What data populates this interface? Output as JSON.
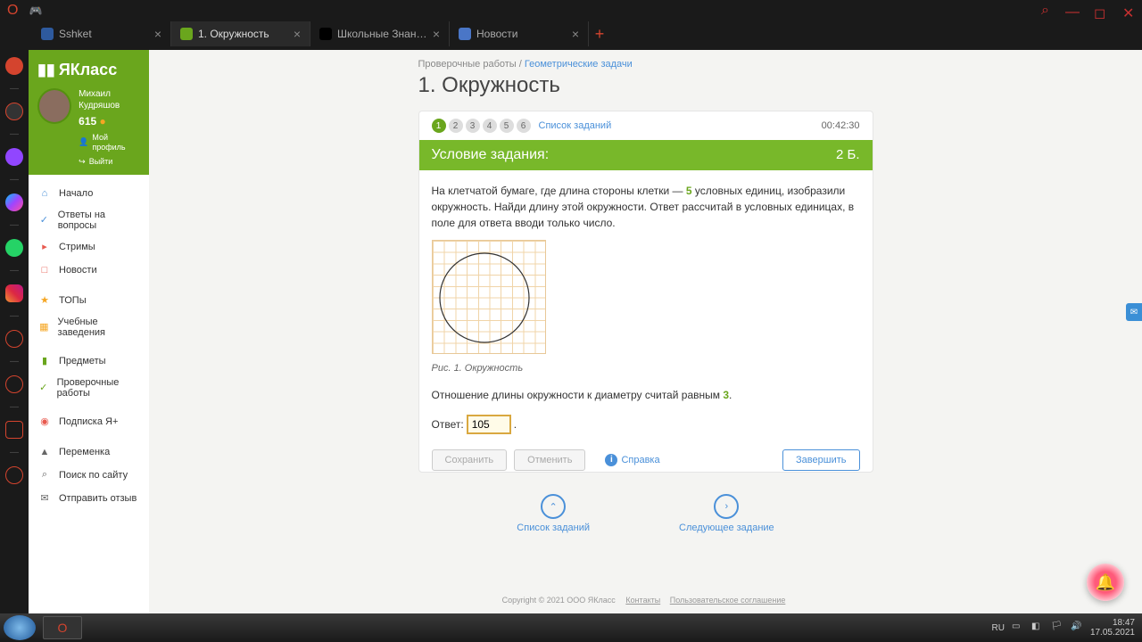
{
  "tabs": [
    {
      "label": "Sshket",
      "icon_bg": "#2e5a9e"
    },
    {
      "label": "1. Окружность",
      "icon_bg": "#6aa61d",
      "active": true
    },
    {
      "label": "Школьные Знания.com - П",
      "icon_bg": "#000"
    },
    {
      "label": "Новости",
      "icon_bg": "#4a76c7"
    }
  ],
  "url": {
    "domain": "www.yaklass.ru",
    "path": "/TestWorkRun/Exercise"
  },
  "sidebar": {
    "logo": "ЯКласс",
    "profile": {
      "name": "Михаил\nКудряшов",
      "score": "615",
      "my_profile": "Мой профиль",
      "logout": "Выйти"
    },
    "menu": [
      {
        "label": "Начало",
        "color": "#4a90d9",
        "glyph": "⌂"
      },
      {
        "label": "Ответы на вопросы",
        "color": "#4a90d9",
        "glyph": "✓"
      },
      {
        "label": "Стримы",
        "color": "#e85a4f",
        "glyph": "▸"
      },
      {
        "label": "Новости",
        "color": "#e85a4f",
        "glyph": "□"
      },
      {
        "sep": true
      },
      {
        "label": "ТОПы",
        "color": "#f5a623",
        "glyph": "★"
      },
      {
        "label": "Учебные заведения",
        "color": "#f5a623",
        "glyph": "▦"
      },
      {
        "sep": true
      },
      {
        "label": "Предметы",
        "color": "#6aa61d",
        "glyph": "▮"
      },
      {
        "label": "Проверочные работы",
        "color": "#6aa61d",
        "glyph": "✓"
      },
      {
        "sep": true
      },
      {
        "label": "Подписка Я+",
        "color": "#e85a4f",
        "glyph": "◉"
      },
      {
        "sep": true
      },
      {
        "label": "Переменка",
        "color": "#666",
        "glyph": "▲"
      },
      {
        "label": "Поиск по сайту",
        "color": "#666",
        "glyph": "⌕"
      },
      {
        "label": "Отправить отзыв",
        "color": "#666",
        "glyph": "✉"
      }
    ]
  },
  "breadcrumb": {
    "a": "Проверочные работы",
    "b": "Геометрические задачи"
  },
  "page_title": "1. Окружность",
  "steps": [
    "1",
    "2",
    "3",
    "4",
    "5",
    "6"
  ],
  "step_list": "Список заданий",
  "timer": "00:42:30",
  "green_bar": {
    "title": "Условие задания:",
    "points": "2 Б."
  },
  "task_text_1": "На клетчатой бумаге, где длина стороны клетки — ",
  "task_num1": "5",
  "task_text_2": " условных единиц, изобразили окружность. Найди длину этой окружности. Ответ рассчитай в условных единицах, в поле для ответа вводи только число.",
  "fig_caption": "Рис. 1. Окружность",
  "ratio_text": "Отношение длины окружности к диаметру считай равным ",
  "ratio_num": "3",
  "answer_label": "Ответ:",
  "answer_value": "105",
  "buttons": {
    "save": "Сохранить",
    "cancel": "Отменить",
    "help": "Справка",
    "finish": "Завершить"
  },
  "bottom_nav": {
    "list": "Список заданий",
    "next": "Следующее задание"
  },
  "footer": {
    "copy": "Copyright © 2021 ООО ЯКласс",
    "a": "Контакты",
    "b": "Пользовательское соглашение"
  },
  "taskbar": {
    "lang": "RU",
    "time": "18:47",
    "date": "17.05.2021"
  }
}
